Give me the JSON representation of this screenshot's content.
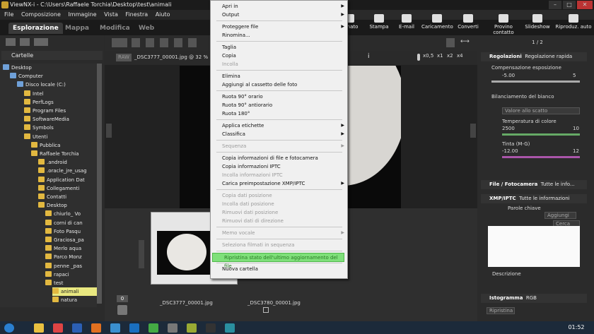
{
  "title": "ViewNX-i - C:\\Users\\Raffaele Torchia\\Desktop\\test\\animali",
  "menubar": [
    "File",
    "Composizione",
    "Immagine",
    "Vista",
    "Finestra",
    "Aiuto"
  ],
  "tabs": [
    "Esplorazione",
    "Mappa",
    "Modifica",
    "Web"
  ],
  "toolbar_right": [
    "...mato",
    "Stampa",
    "E-mail",
    "Caricamento",
    "Converti",
    "Provino contatto",
    "Slideshow",
    "Riproduz. auto"
  ],
  "left_panel": {
    "header": "Cartelle",
    "tree": [
      {
        "label": "Desktop",
        "indent": 0,
        "blue": true
      },
      {
        "label": "Computer",
        "indent": 1,
        "blue": true
      },
      {
        "label": "Disco locale (C:)",
        "indent": 2,
        "blue": true
      },
      {
        "label": "Intel",
        "indent": 3
      },
      {
        "label": "PerfLogs",
        "indent": 3
      },
      {
        "label": "Program Files",
        "indent": 3
      },
      {
        "label": "SoftwareMedia",
        "indent": 3
      },
      {
        "label": "Symbols",
        "indent": 3
      },
      {
        "label": "Utenti",
        "indent": 3
      },
      {
        "label": "Pubblica",
        "indent": 4
      },
      {
        "label": "Raffaele Torchia",
        "indent": 4
      },
      {
        "label": ".android",
        "indent": 5
      },
      {
        "label": ".oracle_jre_usag",
        "indent": 5
      },
      {
        "label": "Application Dat",
        "indent": 5
      },
      {
        "label": "Collegamenti",
        "indent": 5
      },
      {
        "label": "Contatti",
        "indent": 5
      },
      {
        "label": "Desktop",
        "indent": 5
      },
      {
        "label": "chiurlo_ Vo",
        "indent": 6
      },
      {
        "label": "corni di can",
        "indent": 6
      },
      {
        "label": "Foto Pasqu",
        "indent": 6
      },
      {
        "label": "Graciosa_pa",
        "indent": 6
      },
      {
        "label": "Merlo aqua",
        "indent": 6
      },
      {
        "label": "Parco Monz",
        "indent": 6
      },
      {
        "label": "penne _pas",
        "indent": 6
      },
      {
        "label": "rapaci",
        "indent": 6
      },
      {
        "label": "test",
        "indent": 6
      },
      {
        "label": "animali",
        "indent": 7,
        "selected": true
      },
      {
        "label": "natura",
        "indent": 7
      }
    ]
  },
  "viewer": {
    "file_label": "_DSC3777_00001.jpg @ 32 %",
    "raw_badge": "RAW",
    "zoom_labels": [
      "x0,5",
      "x1",
      "x2",
      "x4"
    ],
    "page_counter": "1 / 2",
    "thumbs": [
      "_DSC3777_00001.jpg",
      "_DSC3780_00001.jpg"
    ],
    "count": "0"
  },
  "right_panel": {
    "adjust_header": "Regolazioni",
    "adjust_value": "Regolazione rapida",
    "exposure_label": "Compensazione esposizione",
    "exposure_min": "-5.00",
    "exposure_max": "5",
    "wb_label": "Bilanciamento del bianco",
    "wb_value": "Valore allo scatto",
    "temp_label": "Temperatura di colore",
    "temp_min": "2500",
    "temp_max": "10",
    "tint_label": "Tinta (M-G)",
    "tint_min": "-12.00",
    "tint_max": "12",
    "file_header": "File / Fotocamera",
    "file_value": "Tutte le info...",
    "xmp_header": "XMP/IPTC",
    "xmp_value": "Tutte le informazioni",
    "keywords_label": "Parole chiave",
    "keywords_add": "Aggiungi",
    "keywords_search": "Cerca nuov",
    "description_label": "Descrizione",
    "histogram_header": "Istogramma",
    "histogram_value": "RGB",
    "repaint_btn": "Ripristina"
  },
  "context_menu": [
    {
      "label": "Apri in",
      "arrow": true
    },
    {
      "label": "Output",
      "arrow": true
    },
    {
      "sep": true
    },
    {
      "label": "Proteggere file",
      "arrow": true
    },
    {
      "label": "Rinomina..."
    },
    {
      "sep": true
    },
    {
      "label": "Taglia"
    },
    {
      "label": "Copia"
    },
    {
      "label": "Incolla",
      "disabled": true
    },
    {
      "sep": true
    },
    {
      "label": "Elimina"
    },
    {
      "label": "Aggiungi al cassetto delle foto"
    },
    {
      "sep": true
    },
    {
      "label": "Ruota 90° orario"
    },
    {
      "label": "Ruota 90° antiorario"
    },
    {
      "label": "Ruota 180°"
    },
    {
      "sep": true
    },
    {
      "label": "Applica etichette",
      "arrow": true
    },
    {
      "label": "Classifica",
      "arrow": true
    },
    {
      "sep": true
    },
    {
      "label": "Sequenza",
      "arrow": true,
      "disabled": true
    },
    {
      "sep": true
    },
    {
      "label": "Copia informazioni di file e fotocamera"
    },
    {
      "label": "Copia informazioni IPTC"
    },
    {
      "label": "Incolla informazioni IPTC",
      "disabled": true
    },
    {
      "label": "Carica preimpostazione XMP/IPTC",
      "arrow": true
    },
    {
      "sep": true
    },
    {
      "label": "Copia dati posizione",
      "disabled": true
    },
    {
      "label": "Incolla dati posizione",
      "disabled": true
    },
    {
      "label": "Rimuovi dati posizione",
      "disabled": true
    },
    {
      "label": "Rimuovi dati di direzione",
      "disabled": true
    },
    {
      "sep": true
    },
    {
      "label": "Memo vocale",
      "arrow": true,
      "disabled": true
    },
    {
      "sep": true
    },
    {
      "label": "Seleziona filmati in sequenza",
      "disabled": true
    },
    {
      "sep": true
    },
    {
      "label": "Ripristina stato dell'ultimo aggiornamento del file",
      "highlight": true
    },
    {
      "sep": true
    },
    {
      "label": "Nuova cartella"
    }
  ],
  "taskbar": {
    "time": "01:52",
    "icons": [
      "start-icon",
      "explorer-icon",
      "chrome-icon",
      "word-icon",
      "firefox-icon",
      "ie-icon",
      "outlook-icon",
      "viewnx-icon",
      "app-icon",
      "app2-icon",
      "nx-icon",
      "viewnx-active-icon"
    ],
    "colors": {
      "start": "#2a7fd0",
      "accent": "#7fe07a"
    }
  }
}
